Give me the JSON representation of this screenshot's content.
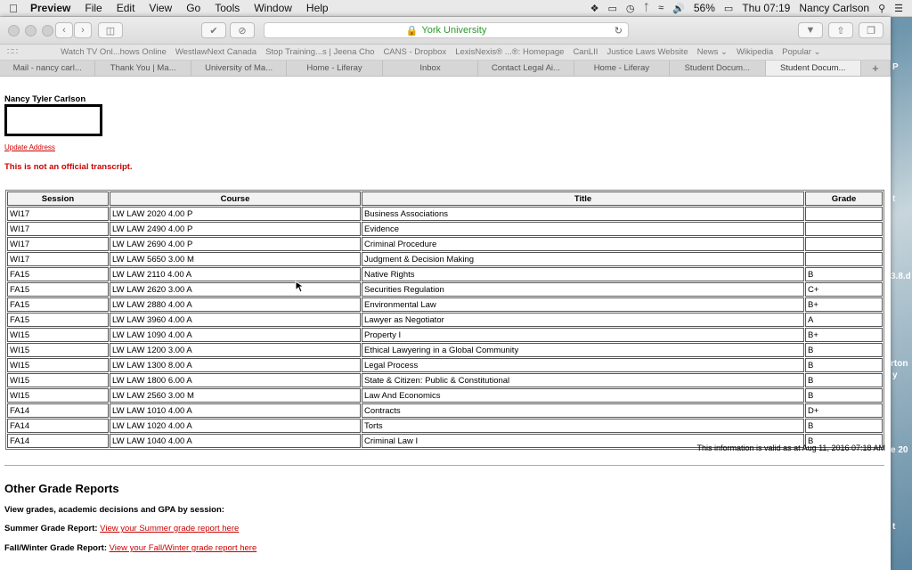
{
  "menubar": {
    "app": "Preview",
    "items": [
      "File",
      "Edit",
      "View",
      "Go",
      "Tools",
      "Window",
      "Help"
    ],
    "battery": "56%",
    "clock": "Thu 07:19",
    "user": "Nancy Carlson"
  },
  "browser": {
    "url": "York University",
    "bookmarks": [
      "Watch TV Onl...hows Online",
      "WestlawNext Canada",
      "Stop Training...s | Jeena Cho",
      "CANS - Dropbox",
      "LexisNexis® ...®: Homepage",
      "CanLII",
      "Justice Laws Website",
      "News ⌄",
      "Wikipedia",
      "Popular ⌄"
    ],
    "tabs": [
      "Mail - nancy carl...",
      "Thank You | Ma...",
      "University of Ma...",
      "Home - Liferay",
      "Inbox",
      "Contact Legal Ai...",
      "Home - Liferay",
      "Student Docum...",
      "Student Docum..."
    ]
  },
  "page": {
    "student_name": "Nancy Tyler Carlson",
    "update_address": "Update Address",
    "disclaimer": "This is not an official transcript.",
    "columns": [
      "Session",
      "Course",
      "Title",
      "Grade"
    ],
    "rows": [
      {
        "session": "WI17",
        "course": "LW LAW  2020  4.00 P",
        "title": "Business Associations",
        "grade": ""
      },
      {
        "session": "WI17",
        "course": "LW LAW  2490  4.00 P",
        "title": "Evidence",
        "grade": ""
      },
      {
        "session": "WI17",
        "course": "LW LAW  2690  4.00 P",
        "title": "Criminal Procedure",
        "grade": ""
      },
      {
        "session": "WI17",
        "course": "LW LAW  5650  3.00 M",
        "title": "Judgment & Decision Making",
        "grade": ""
      },
      {
        "session": "FA15",
        "course": "LW LAW  2110  4.00 A",
        "title": "Native Rights",
        "grade": "B"
      },
      {
        "session": "FA15",
        "course": "LW LAW  2620  3.00 A",
        "title": "Securities Regulation",
        "grade": "C+"
      },
      {
        "session": "FA15",
        "course": "LW LAW  2880  4.00 A",
        "title": "Environmental Law",
        "grade": "B+"
      },
      {
        "session": "FA15",
        "course": "LW LAW  3960  4.00 A",
        "title": "Lawyer as Negotiator",
        "grade": "A"
      },
      {
        "session": "WI15",
        "course": "LW LAW  1090  4.00 A",
        "title": "Property I",
        "grade": "B+"
      },
      {
        "session": "WI15",
        "course": "LW LAW  1200  3.00 A",
        "title": "Ethical Lawyering in a Global Community",
        "grade": "B"
      },
      {
        "session": "WI15",
        "course": "LW LAW  1300  8.00 A",
        "title": "Legal Process",
        "grade": "B"
      },
      {
        "session": "WI15",
        "course": "LW LAW  1800  6.00 A",
        "title": "State & Citizen: Public & Constitutional",
        "grade": "B"
      },
      {
        "session": "WI15",
        "course": "LW LAW  2560  3.00 M",
        "title": "Law And Economics",
        "grade": "B"
      },
      {
        "session": "FA14",
        "course": "LW LAW  1010  4.00 A",
        "title": "Contracts",
        "grade": "D+"
      },
      {
        "session": "FA14",
        "course": "LW LAW  1020  4.00 A",
        "title": "Torts",
        "grade": "B"
      },
      {
        "session": "FA14",
        "course": "LW LAW  1040  4.00 A",
        "title": "Criminal Law I",
        "grade": "B"
      }
    ],
    "valid_note": "This information is valid as at Aug 11, 2016 07:18 AM",
    "other_heading": "Other Grade Reports",
    "other_sub": "View grades, academic decisions and GPA by session:",
    "summer_label": "Summer Grade Report:",
    "summer_link": "View your Summer grade report here",
    "fallwinter_label": "Fall/Winter Grade Report:",
    "fallwinter_link": "View your Fall/Winter grade report here"
  },
  "desktop_fragments": [
    "P",
    "t",
    "3.8.d",
    "rton",
    "y",
    "e 20",
    "t"
  ]
}
